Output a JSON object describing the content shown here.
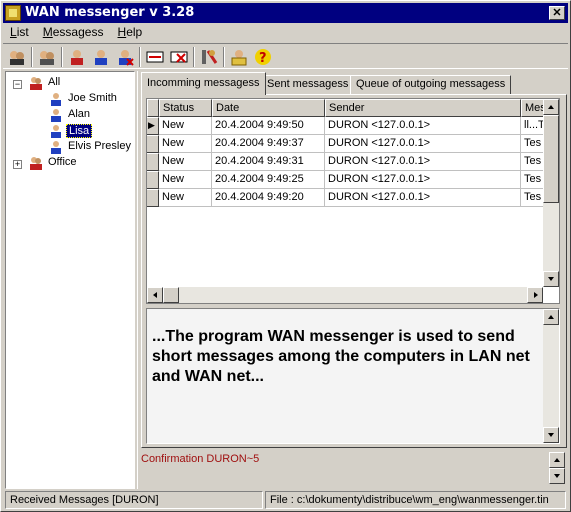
{
  "window": {
    "title": "WAN messenger v 3.28",
    "close_glyph": "✕"
  },
  "menu": {
    "items": [
      "List",
      "Messagess",
      "Help"
    ]
  },
  "toolbar": {
    "icons": [
      "contacts-icon",
      "contacts-all-icon",
      "user-red-icon",
      "user-blue-icon",
      "user-delete-icon",
      "message-icon",
      "message-delete-icon",
      "tools-icon",
      "contacts-book-icon",
      "help-icon"
    ]
  },
  "tree": {
    "root": "All",
    "root_expander": "−",
    "children": [
      "Joe Smith",
      "Alan",
      "Lisa",
      "Elvis Presley"
    ],
    "selected": "Lisa",
    "office": "Office",
    "office_expander": "+"
  },
  "tabs": [
    "Incomming messagess",
    "Sent messagess",
    "Queue of outgoing messagess"
  ],
  "grid": {
    "columns": [
      "Status",
      "Date",
      "Sender",
      "Mes"
    ],
    "current_row_indicator": "▶",
    "rows": [
      [
        "New",
        "20.4.2004 9:49:50",
        "DURON <127.0.0.1>",
        "ll...T"
      ],
      [
        "New",
        "20.4.2004 9:49:37",
        "DURON <127.0.0.1>",
        "Tes"
      ],
      [
        "New",
        "20.4.2004 9:49:31",
        "DURON <127.0.0.1>",
        "Tes"
      ],
      [
        "New",
        "20.4.2004 9:49:25",
        "DURON <127.0.0.1>",
        "Tes"
      ],
      [
        "New",
        "20.4.2004 9:49:20",
        "DURON <127.0.0.1>",
        "Tes"
      ]
    ]
  },
  "preview": {
    "text": "...The program WAN messenger is used to send short messages among the computers in LAN net and WAN net..."
  },
  "confirmation": "Confirmation DURON~5",
  "status": {
    "left": "Received Messages [DURON]",
    "right": "File : c:\\dokumenty\\distribuce\\wm_eng\\wanmessenger.tin"
  },
  "colors": {
    "titlebar": "#000080",
    "face": "#d4d0c8",
    "confirmation": "#a01010"
  }
}
